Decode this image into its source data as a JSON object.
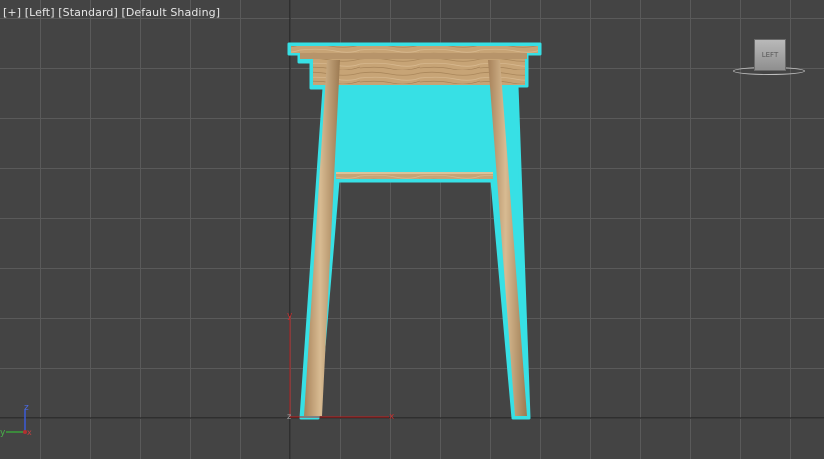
{
  "viewport": {
    "labels": {
      "plus": "[+]",
      "view": "[Left]",
      "preset": "[Standard]",
      "shading": "[Default Shading]"
    },
    "viewcube_label": "LEFT",
    "gizmo": {
      "x": "x",
      "y": "y",
      "z": "z"
    },
    "triad": {
      "z": "z",
      "y": "y",
      "x": "x"
    }
  },
  "colors": {
    "background": "#444444",
    "grid": "#5a5a5a",
    "grid_axis": "#1a1a1a",
    "selection": "#37e0e5",
    "wood": "#c9a67a"
  },
  "object": {
    "name": "stool",
    "selected": true
  }
}
